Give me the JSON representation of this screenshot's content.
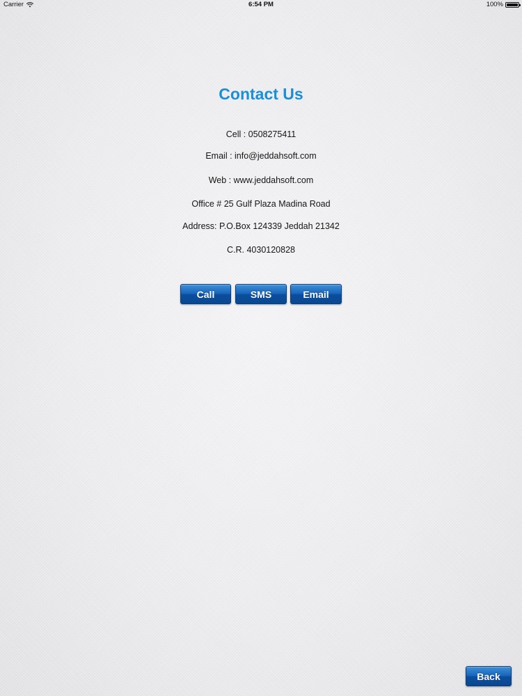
{
  "status_bar": {
    "carrier": "Carrier",
    "time": "6:54 PM",
    "battery": "100%"
  },
  "title": "Contact Us",
  "info": {
    "cell": "Cell : 0508275411",
    "email": "Email : info@jeddahsoft.com",
    "web": "Web : www.jeddahsoft.com",
    "office": "Office # 25 Gulf Plaza Madina Road",
    "address": "Address: P.O.Box 124339 Jeddah 21342",
    "cr": "C.R. 4030120828"
  },
  "buttons": {
    "call": "Call",
    "sms": "SMS",
    "email": "Email",
    "back": "Back"
  },
  "colors": {
    "title": "#1a8fd6",
    "button": "#1765bb"
  }
}
